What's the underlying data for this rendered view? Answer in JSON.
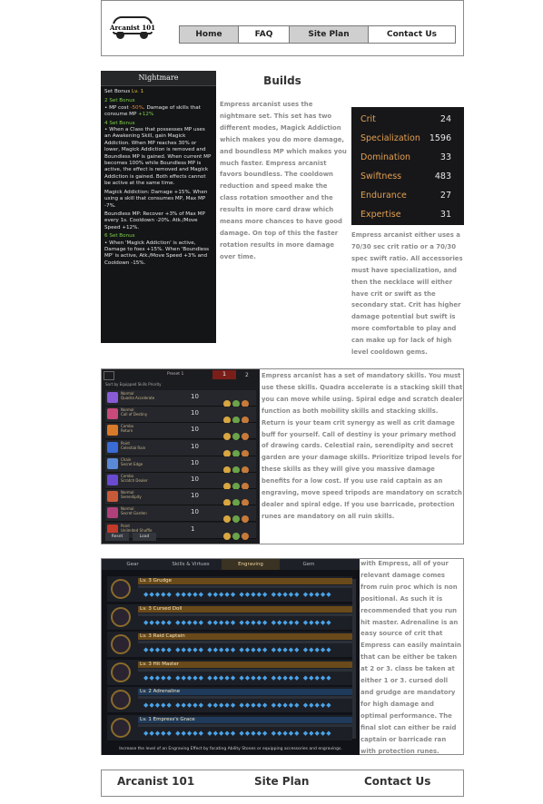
{
  "header": {
    "logo_text": "Arcanist 101",
    "nav": [
      {
        "label": "Home",
        "active": true
      },
      {
        "label": "FAQ",
        "active": false
      },
      {
        "label": "Site Plan",
        "active": true
      },
      {
        "label": "Contact Us",
        "active": false
      }
    ]
  },
  "builds_title": "Builds",
  "nightmare": {
    "title": "Nightmare",
    "set_bonus_label": "Set Bonus",
    "set_bonus_level": "Lv. 1",
    "two_set": "2 Set Bonus",
    "two_set_text_a": "• MP cost",
    "two_set_val_a": "-50%",
    "two_set_text_b": ". Damage of skills that consume MP",
    "two_set_val_b": "+12%",
    "four_set": "4 Set Bonus",
    "four_set_text": "• When a Class that possesses MP uses an Awakening Skill, gain Magick Addiction. When MP reaches 30% or lower, Magick Addiction is removed and Boundless MP is gained. When current MP becomes 100% while Boundless MP is active, the effect is removed and Magick Addiction is gained. Both effects cannot be active at the same time.",
    "four_set_text2": "Magick Addiction: Damage +15%. When using a skill that consumes MP, Max MP -7%.",
    "four_set_text3": "Boundless MP: Recover +3% of Max MP every 1s. Cooldown -20%. Atk./Move Speed +12%.",
    "six_set": "6 Set Bonus",
    "six_set_text": "• When 'Magick Addiction' is active, Damage to foes +15%. When 'Boundless MP' is active, Atk./Move Speed +3% and Cooldown -15%."
  },
  "builds_paragraph": "Empress arcanist uses the nightmare set. This set has two different modes, Magick Addiction which makes you do more damage, and boundless MP which makes you much faster. Empress arcanist favors boundless. The cooldown reduction and speed make the class rotation smoother and the results in more card draw which means more chances to have good damage. On top of this the faster rotation results in more damage over time.",
  "stats": [
    {
      "name": "Crit",
      "value": "24"
    },
    {
      "name": "Specialization",
      "value": "1596"
    },
    {
      "name": "Domination",
      "value": "33"
    },
    {
      "name": "Swiftness",
      "value": "483"
    },
    {
      "name": "Endurance",
      "value": "27"
    },
    {
      "name": "Expertise",
      "value": "31"
    }
  ],
  "stats_paragraph": "Empress arcanist either uses a 70/30 sec crit ratio or a 70/30 spec swift ratio.  All accessories must have specialization, and then the necklace will either have crit or swift as the secondary stat. Crit has higher damage potential but swift is more comfortable to play and can make up for lack of high level cooldown gems.",
  "skills": {
    "preset_label": "Preset 1",
    "preset_num": "1",
    "preset_num2": "2",
    "sort_label": "Sort by Equipped Skills Priority",
    "reset_label": "Reset",
    "load_label": "Load",
    "rows": [
      {
        "type": "Normal",
        "name": "Quadra Accelerate",
        "level": "10",
        "color": "#8a5bd6"
      },
      {
        "type": "Normal",
        "name": "Call of Destiny",
        "level": "10",
        "color": "#c84a7a"
      },
      {
        "type": "Combo",
        "name": "Return",
        "level": "10",
        "color": "#d87a2a"
      },
      {
        "type": "Point",
        "name": "Celestial Rain",
        "level": "10",
        "color": "#3a6bd6"
      },
      {
        "type": "Chain",
        "name": "Secret Edge",
        "level": "10",
        "color": "#5a8ad6"
      },
      {
        "type": "Combo",
        "name": "Scratch Dealer",
        "level": "10",
        "color": "#6a4ad0"
      },
      {
        "type": "Normal",
        "name": "Serendipity",
        "level": "10",
        "color": "#c85a3a"
      },
      {
        "type": "Normal",
        "name": "Secret Garden",
        "level": "10",
        "color": "#b0407a"
      },
      {
        "type": "Point",
        "name": "Unlimited Shuffle",
        "level": "1",
        "color": "#c23a2a"
      }
    ]
  },
  "skills_paragraph": "Empress arcanist has a set of mandatory skills. You must use these skills. Quadra accelerate is a stacking skill that you can move while using. Spiral edge and scratch dealer function as both mobility skills and stacking skills. Return is your team crit synergy as well as crit damage buff for yourself. Call of destiny is your primary method of drawing cards. Celestial rain, serendipity and secret garden are your damage skills. Prioritize tripod levels for these skills as they will give you massive damage benefits for a low cost. If you use raid captain as an engraving, move speed tripods are mandatory on scratch dealer and spiral edge. If you use barricade, protection runes are mandatory on all ruin skills.",
  "engravings": {
    "tabs": [
      "Gear",
      "Skills & Virtues",
      "Engraving",
      "Gem"
    ],
    "active_tab": "Engraving",
    "rows": [
      {
        "title": "Lv. 3 Grudge"
      },
      {
        "title": "Lv. 3 Cursed Doll"
      },
      {
        "title": "Lv. 3 Raid Captain"
      },
      {
        "title": "Lv. 3 Hit Master"
      },
      {
        "title": "Lv. 2 Adrenaline"
      },
      {
        "title": "Lv. 1 Empress's Grace"
      }
    ],
    "footer_text": "Increase the level of an Engraving Effect by focating Ability Stones or equipping accessories and engravings."
  },
  "engravings_paragraph": "with Empress, all of your relevant damage comes from ruin proc which is non positional. As such it is recommended that you run hit master. Adrenaline is an easy source of crit that Empress can easily maintain that can be either be taken at 2 or 3. class be taken at either 1 or 3. cursed doll and grudge are mandatory for high damage and optimal performance. The final slot can either be raid captain or barricade ran with protection runes.",
  "footer": {
    "brand": "Arcanist 101",
    "site_plan": "Site Plan",
    "contact": "Contact Us"
  }
}
